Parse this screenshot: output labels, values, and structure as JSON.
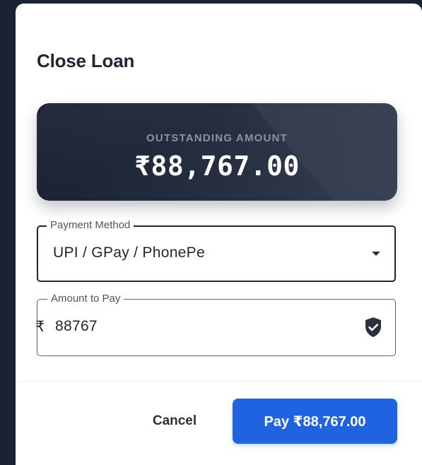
{
  "dialog": {
    "title": "Close Loan"
  },
  "outstanding": {
    "label": "OUTSTANDING AMOUNT",
    "amount": "₹88,767.00"
  },
  "payment_method": {
    "label": "Payment Method",
    "selected": "UPI / GPay / PhonePe",
    "icon": "chevron-down-icon"
  },
  "amount_to_pay": {
    "label": "Amount to Pay",
    "currency_prefix": "₹",
    "value": "88767",
    "icon": "shield-check-icon"
  },
  "actions": {
    "cancel_label": "Cancel",
    "pay_label": "Pay ₹88,767.00"
  },
  "colors": {
    "accent": "#1f63e0",
    "card_dark": "#1a2233",
    "backdrop": "#1b2231"
  }
}
